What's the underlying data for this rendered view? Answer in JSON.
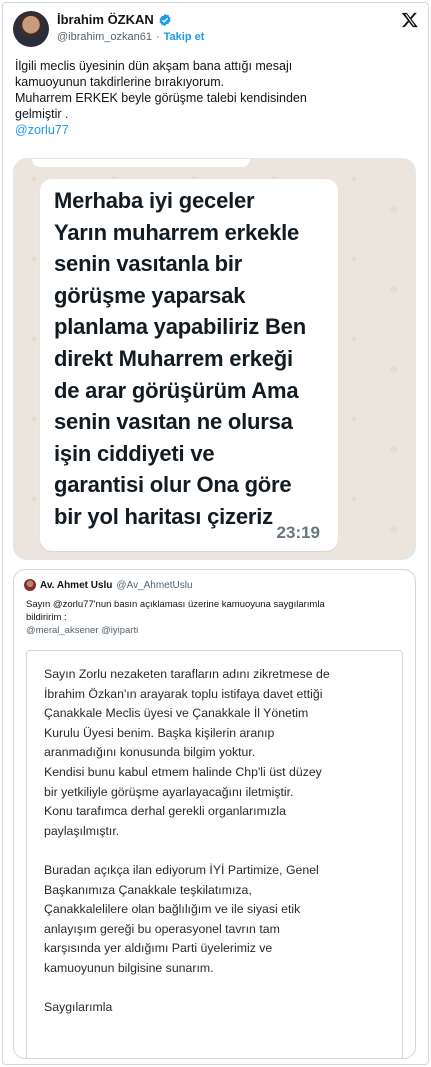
{
  "author": {
    "name": "İbrahim ÖZKAN",
    "handle": "@ibrahim_ozkan61",
    "separator": "·",
    "follow_label": "Takip et"
  },
  "tweet": {
    "lines": [
      "İlgili meclis üyesinin dün akşam bana attığı mesajı",
      "kamuoyunun takdirlerine bırakıyorum.",
      "Muharrem ERKEK beyle görüşme talebi kendisinden",
      "gelmiştir ."
    ],
    "mention": "@zorlu77"
  },
  "whatsapp": {
    "message_lines": [
      "Merhaba iyi geceler",
      "Yarın muharrem erkekle",
      "senin vasıtanla bir",
      "görüşme yaparsak",
      "planlama yapabiliriz Ben",
      "direkt Muharrem erkeği",
      "de arar görüşürüm Ama",
      "senin vasıtan ne olursa",
      "işin ciddiyeti ve",
      "garantisi olur Ona göre",
      "bir yol haritası çizeriz"
    ],
    "time": "23:19"
  },
  "quote": {
    "name": "Av. Ahmet Uslu",
    "handle": "@Av_AhmetUslu",
    "text_line1": "Sayın @zorlu77'nun basın açıklaması üzerine kamuoyuna saygılarımla",
    "text_line2": "bildiririm :",
    "mentions": "@meral_aksener @iyiparti",
    "document": {
      "paragraph1": [
        "Sayın Zorlu nezaketen tarafların adını zikretmese de",
        "İbrahim Özkan'ın arayarak toplu istifaya davet ettiği",
        "Çanakkale Meclis üyesi ve Çanakkale İl Yönetim",
        "Kurulu Üyesi benim. Başka kişilerin aranıp",
        "aranmadığını konusunda bilgim yoktur.",
        "Kendisi bunu kabul etmem halinde Chp'li üst düzey",
        "bir yetkiliyle görüşme ayarlayacağını iletmiştir.",
        "Konu tarafımca derhal gerekli organlarımızla",
        "paylaşılmıştır."
      ],
      "paragraph2": [
        "Buradan açıkça ilan ediyorum İYİ Partimize, Genel",
        "Başkanımıza Çanakkale teşkilatımıza,",
        "Çanakkalelilere olan bağlılığım ve ile siyasi etik",
        "anlayışım gereği bu operasyonel tavrın tam",
        "karşısında yer aldığımı Parti üyelerimiz ve",
        "kamuoyunun bilgisine sunarım."
      ],
      "closing": "Saygılarımla"
    }
  },
  "colors": {
    "accent": "#1d9bf0",
    "whatsapp_bg": "#ece5dd",
    "text": "#0f1419",
    "secondary": "#536471"
  }
}
